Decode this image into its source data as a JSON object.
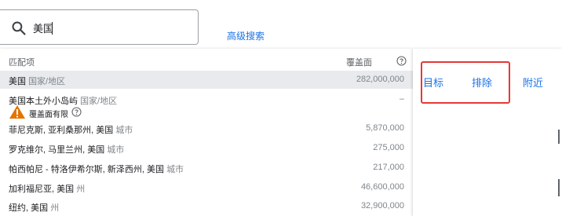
{
  "search": {
    "value": "美国",
    "advanced_link": "高级搜索"
  },
  "header": {
    "match_label": "匹配项",
    "reach_label": "覆盖面"
  },
  "results": [
    {
      "name": "美国",
      "type": "国家/地区",
      "reach": "282,000,000"
    },
    {
      "name": "美国本土外小岛屿",
      "type": "国家/地区",
      "reach": "–"
    },
    {
      "name": "菲尼克斯, 亚利桑那州, 美国",
      "type": "城市",
      "reach": "5,870,000"
    },
    {
      "name": "罗克维尔, 马里兰州, 美国",
      "type": "城市",
      "reach": "275,000"
    },
    {
      "name": "帕西帕尼 - 特洛伊希尔斯, 新泽西州, 美国",
      "type": "城市",
      "reach": "217,000"
    },
    {
      "name": "加利福尼亚, 美国",
      "type": "州",
      "reach": "46,600,000"
    },
    {
      "name": "纽约, 美国",
      "type": "州",
      "reach": "32,900,000"
    }
  ],
  "warning": {
    "text": "覆盖面有限"
  },
  "actions": {
    "target": "目标",
    "exclude": "排除",
    "nearby": "附近"
  },
  "colors": {
    "link": "#1a73e8",
    "highlight_border": "#e53935",
    "warning": "#e37400",
    "selected_row": "#e8eaed"
  }
}
